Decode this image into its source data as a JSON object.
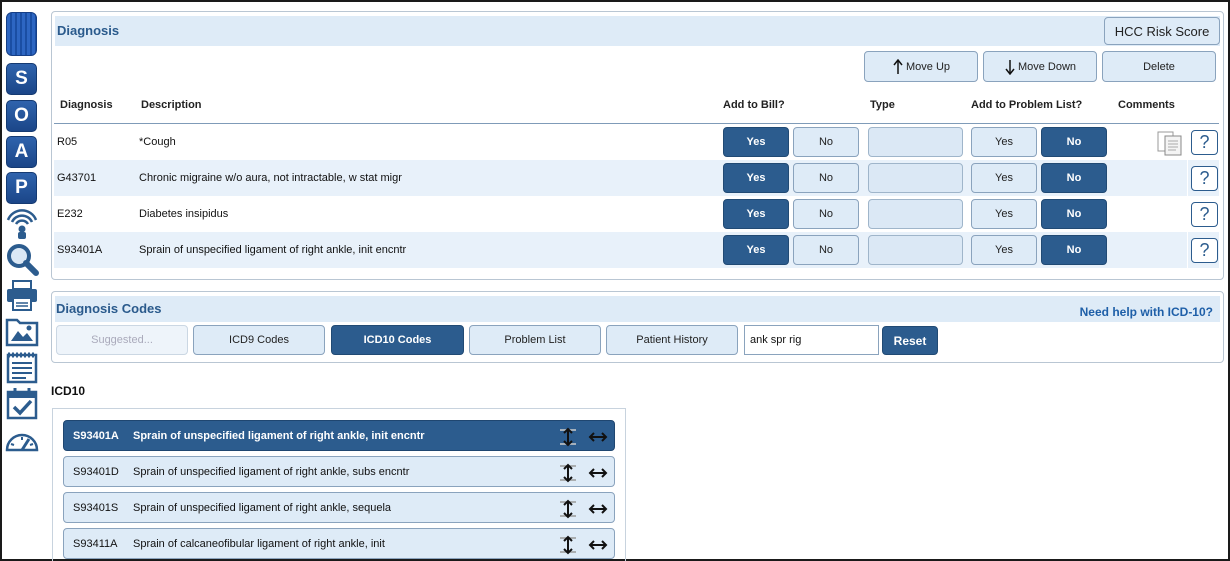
{
  "diagnosis_panel": {
    "title": "Diagnosis",
    "hcc_label": "HCC Risk Score",
    "move_up": "Move Up",
    "move_down": "Move Down",
    "delete": "Delete",
    "columns": {
      "diagnosis": "Diagnosis",
      "description": "Description",
      "add_to_bill": "Add to Bill?",
      "type": "Type",
      "add_to_problem_list": "Add to Problem List?",
      "comments": "Comments"
    },
    "rows": [
      {
        "code": "R05",
        "description": "*Cough",
        "bill_yes": "Yes",
        "bill_no": "No",
        "pl_yes": "Yes",
        "pl_no": "No",
        "help": "?"
      },
      {
        "code": "G43701",
        "description": "Chronic migraine w/o aura, not intractable, w stat migr",
        "bill_yes": "Yes",
        "bill_no": "No",
        "pl_yes": "Yes",
        "pl_no": "No",
        "help": "?"
      },
      {
        "code": "E232",
        "description": "Diabetes insipidus",
        "bill_yes": "Yes",
        "bill_no": "No",
        "pl_yes": "Yes",
        "pl_no": "No",
        "help": "?"
      },
      {
        "code": "S93401A",
        "description": "Sprain of unspecified ligament of right ankle, init encntr",
        "bill_yes": "Yes",
        "bill_no": "No",
        "pl_yes": "Yes",
        "pl_no": "No",
        "help": "?"
      }
    ]
  },
  "codes_panel": {
    "title": "Diagnosis Codes",
    "help_link": "Need help with ICD-10?",
    "tabs": [
      "Suggested...",
      "ICD9 Codes",
      "ICD10 Codes",
      "Problem List",
      "Patient History"
    ],
    "search_value": "ank spr rig",
    "reset": "Reset"
  },
  "results": {
    "label": "ICD10",
    "items": [
      {
        "code": "S93401A",
        "description": "Sprain of unspecified ligament of right ankle, init encntr"
      },
      {
        "code": "S93401D",
        "description": "Sprain of unspecified ligament of right ankle, subs encntr"
      },
      {
        "code": "S93401S",
        "description": "Sprain of unspecified ligament of right ankle, sequela"
      },
      {
        "code": "S93411A",
        "description": "Sprain of calcaneofibular ligament of right ankle, init"
      }
    ]
  },
  "sidebar": {
    "soap": [
      "S",
      "O",
      "A",
      "P"
    ],
    "icons": [
      "wireless-icon",
      "search-icon",
      "printer-icon",
      "image-folder-icon",
      "notepad-icon",
      "calendar-check-icon",
      "dashboard-icon"
    ]
  },
  "colors": {
    "dark_blue": "#2c5c8e",
    "light_blue": "#deebf7",
    "title_blue": "#2a5a8c"
  }
}
